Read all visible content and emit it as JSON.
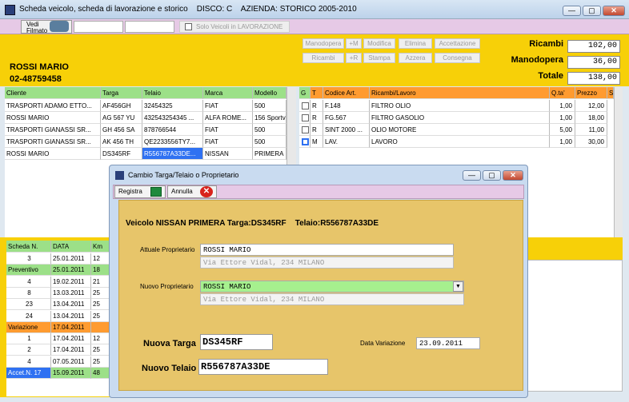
{
  "window": {
    "title": "Scheda veicolo, scheda di lavorazione e storico    DISCO: C    AZIENDA: STORICO 2005-2010",
    "min": "—",
    "max": "▢",
    "close": "✕"
  },
  "toolbar": {
    "vedi": "Vedi Filmato",
    "solo": "Solo Veicoli in LAVORAZIONE"
  },
  "customer": {
    "name": "ROSSI MARIO",
    "phone": "02-48759458"
  },
  "action_buttons": [
    "Manodopera",
    "+M",
    "Modifica",
    "Elimina",
    "Accettazione",
    "Ricambi",
    "+R",
    "Stampa",
    "Azzera",
    "Consegna"
  ],
  "totals": {
    "ricambi_label": "Ricambi",
    "ricambi": "102,00",
    "manodopera_label": "Manodopera",
    "manodopera": "36,00",
    "totale_label": "Totale",
    "totale": "138,00"
  },
  "vehicles": {
    "headers": [
      "Cliente",
      "Targa",
      "Telaio",
      "Marca",
      "Modello"
    ],
    "rows": [
      [
        "TRASPORTI ADAMO ETTO...",
        "AF456GH",
        "32454325",
        "FIAT",
        "500"
      ],
      [
        "ROSSI MARIO",
        "AG 567 YU",
        "432543254345 ...",
        "ALFA ROME...",
        "156 Sportv"
      ],
      [
        "TRASPORTI GIANASSI SR...",
        "GH 456 SA",
        "878766544",
        "FIAT",
        "500"
      ],
      [
        "TRASPORTI GIANASSI SR...",
        "AK 456 TH",
        "QE2233556TY7...",
        "FIAT",
        "500"
      ],
      [
        "ROSSI MARIO",
        "DS345RF",
        "R556787A33DE...",
        "NISSAN",
        "PRIMERA"
      ]
    ]
  },
  "parts": {
    "headers": [
      "G",
      "T",
      "Codice Art.",
      "Ricambi/Lavoro",
      "Q.ta'",
      "Prezzo",
      "S"
    ],
    "rows": [
      [
        "R",
        "F.148",
        "FILTRO OLIO",
        "1,00",
        "12,00"
      ],
      [
        "R",
        "FG.567",
        "FILTRO GASOLIO",
        "1,00",
        "18,00"
      ],
      [
        "R",
        "SINT 2000 ...",
        "OLIO MOTORE",
        "5,00",
        "11,00"
      ],
      [
        "M",
        "LAV.",
        "LAVORO",
        "1,00",
        "30,00"
      ]
    ]
  },
  "history": {
    "headers": [
      "Scheda N.",
      "DATA",
      "Km"
    ],
    "rows": [
      [
        "3",
        "25.01.2011",
        "12"
      ],
      [
        "Preventivo",
        "25.01.2011",
        "18"
      ],
      [
        "4",
        "19.02.2011",
        "21"
      ],
      [
        "8",
        "13.03.2011",
        "25"
      ],
      [
        "23",
        "13.04.2011",
        "25"
      ],
      [
        "24",
        "13.04.2011",
        "25"
      ],
      [
        "Variazione",
        "17.04.2011",
        ""
      ],
      [
        "1",
        "17.04.2011",
        "12"
      ],
      [
        "2",
        "17.04.2011",
        "25"
      ],
      [
        "4",
        "07.05.2011",
        "25"
      ],
      [
        "Accet.N.   17",
        "15.09.2011",
        "48"
      ]
    ]
  },
  "dialog": {
    "title": "Cambio Targa/Telaio o Proprietario",
    "registra": "Registra",
    "annulla": "Annulla",
    "heading": "Veicolo NISSAN PRIMERA Targa:DS345RF    Telaio:R556787A33DE",
    "attuale_label": "Attuale Proprietario",
    "attuale": "ROSSI MARIO",
    "attuale_addr": "Via Ettore Vidal, 234 MILANO",
    "nuovo_label": "Nuovo Proprietario",
    "nuovo": "ROSSI MARIO",
    "nuovo_addr": "Via Ettore Vidal, 234 MILANO",
    "targa_label": "Nuova Targa",
    "targa": "DS345RF",
    "data_label": "Data Variazione",
    "data": "23.09.2011",
    "telaio_label": "Nuovo Telaio",
    "telaio": "R556787A33DE"
  }
}
